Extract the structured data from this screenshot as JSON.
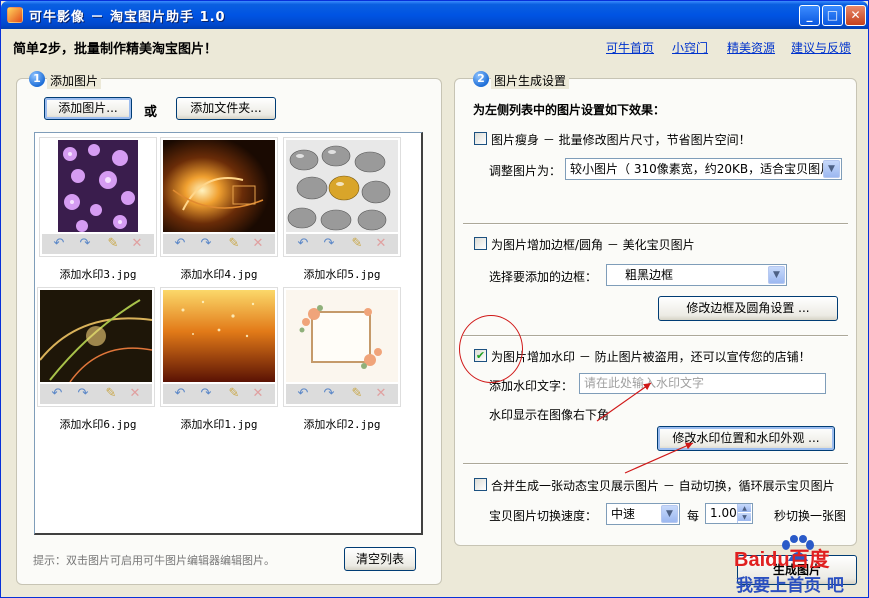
{
  "window": {
    "title": "可牛影像 － 淘宝图片助手 1.0",
    "minimize": "_",
    "maximize": "□",
    "close": "✕"
  },
  "header": {
    "slogan": "简单2步，批量制作精美淘宝图片！",
    "links": [
      "可牛首页",
      "小窍门",
      "精美资源",
      "建议与反馈"
    ]
  },
  "left": {
    "step": "1",
    "title": "添加图片",
    "add_image_button": "添加图片...",
    "or_text": "或",
    "add_folder_button": "添加文件夹...",
    "thumbnails": [
      {
        "label": "添加水印3.jpg"
      },
      {
        "label": "添加水印4.jpg"
      },
      {
        "label": "添加水印5.jpg"
      },
      {
        "label": "添加水印6.jpg"
      },
      {
        "label": "添加水印1.jpg"
      },
      {
        "label": "添加水印2.jpg"
      }
    ],
    "tip": "提示：双击图片可启用可牛图片编辑器编辑图片。",
    "clear_button": "清空列表"
  },
  "right": {
    "step": "2",
    "title": "图片生成设置",
    "heading": "为左侧列表中的图片设置如下效果：",
    "slim": {
      "checked": false,
      "label": "图片瘦身 － 批量修改图片尺寸，节省图片空间！",
      "size_label": "调整图片为：",
      "size_value": "较小图片（ 310像素宽，约20KB，适合宝贝图片）"
    },
    "border": {
      "checked": false,
      "label": "为图片增加边框/圆角 － 美化宝贝图片",
      "select_label": "选择要添加的边框：",
      "select_value": "粗黑边框",
      "modify_button": "修改边框及圆角设置 ..."
    },
    "watermark": {
      "checked": true,
      "label": "为图片增加水印 － 防止图片被盗用，还可以宣传您的店铺！",
      "text_label": "添加水印文字：",
      "text_placeholder": "请在此处输入水印文字",
      "position_text": "水印显示在图像右下角",
      "modify_button": "修改水印位置和水印外观 ..."
    },
    "merge": {
      "checked": false,
      "label": "合并生成一张动态宝贝展示图片 － 自动切换，循环展示宝贝图片",
      "speed_label": "宝贝图片切换速度：",
      "speed_value": "中速",
      "every_label": "每",
      "seconds_value": "1.00",
      "suffix_label": "秒切换一张图"
    },
    "generate_partial": "生成图片"
  },
  "overlay": {
    "baidu_logo": "Baidu百度",
    "baidu_slogan": "我要上首页 吧"
  },
  "colors": {
    "link": "#0033cc",
    "title_bar": "#0054e3",
    "annotation": "#d01818",
    "check": "#21a121"
  }
}
